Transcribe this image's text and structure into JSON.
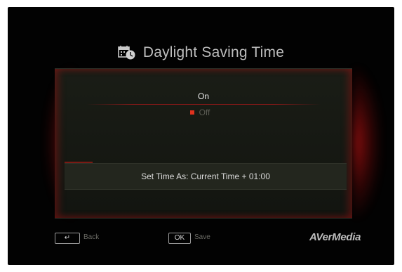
{
  "header": {
    "title": "Daylight Saving Time",
    "icon": "calendar-clock-icon"
  },
  "options": {
    "items": [
      {
        "label": "On",
        "selected": false,
        "highlighted": true
      },
      {
        "label": "Off",
        "selected": true,
        "highlighted": false
      }
    ]
  },
  "info": {
    "text": "Set Time As: Current Time + 01:00"
  },
  "footer": {
    "back_key": "↵",
    "back_label": "Back",
    "ok_key": "OK",
    "save_label": "Save",
    "brand": "AVerMedia"
  },
  "colors": {
    "accent": "#e0321e",
    "glow": "#c81414",
    "panel": "#121410",
    "background": "#020202"
  }
}
